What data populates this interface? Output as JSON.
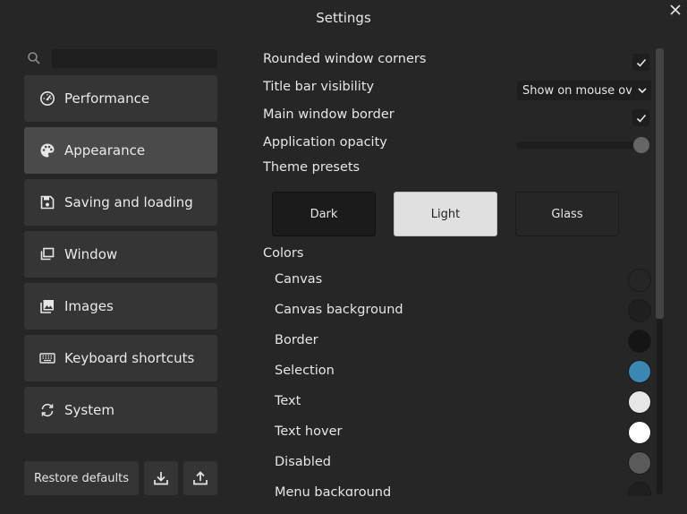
{
  "window": {
    "title": "Settings"
  },
  "search": {
    "placeholder": ""
  },
  "sidebar": {
    "items": [
      {
        "label": "Performance",
        "icon": "speedometer-icon",
        "active": false
      },
      {
        "label": "Appearance",
        "icon": "palette-icon",
        "active": true
      },
      {
        "label": "Saving and loading",
        "icon": "save-icon",
        "active": false
      },
      {
        "label": "Window",
        "icon": "window-icon",
        "active": false
      },
      {
        "label": "Images",
        "icon": "image-icon",
        "active": false
      },
      {
        "label": "Keyboard shortcuts",
        "icon": "keyboard-icon",
        "active": false
      },
      {
        "label": "System",
        "icon": "sync-icon",
        "active": false
      }
    ]
  },
  "footer": {
    "restore_label": "Restore defaults",
    "import_icon": "download-icon",
    "export_icon": "upload-icon"
  },
  "settings": {
    "rounded_corners": {
      "label": "Rounded window corners",
      "checked": true
    },
    "title_bar": {
      "label": "Title bar visibility",
      "value": "Show on mouse over"
    },
    "main_border": {
      "label": "Main window border",
      "checked": true
    },
    "opacity": {
      "label": "Application opacity",
      "value_fraction": 1.0
    },
    "presets": {
      "label": "Theme presets",
      "options": [
        "Dark",
        "Light",
        "Glass"
      ],
      "selected": "Light"
    },
    "colors": {
      "label": "Colors",
      "items": [
        {
          "label": "Canvas",
          "color": "#262626"
        },
        {
          "label": "Canvas background",
          "color": "#1f1f1f"
        },
        {
          "label": "Border",
          "color": "#141414"
        },
        {
          "label": "Selection",
          "color": "#3a87b3"
        },
        {
          "label": "Text",
          "color": "#e6e6e6"
        },
        {
          "label": "Text hover",
          "color": "#ffffff"
        },
        {
          "label": "Disabled",
          "color": "#5a5a5a"
        },
        {
          "label": "Menu background",
          "color": "#1f1f1f"
        }
      ]
    }
  }
}
